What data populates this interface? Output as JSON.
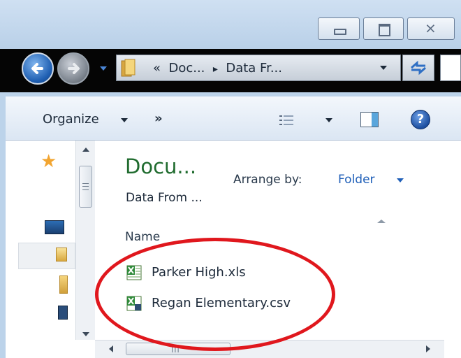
{
  "window": {
    "caption_buttons": [
      "minimize",
      "maximize",
      "close"
    ],
    "close_glyph": "⨯"
  },
  "address_bar": {
    "breadcrumb_prefix": "«",
    "breadcrumb": [
      "Doc...",
      "Data Fr..."
    ],
    "separator": "▸"
  },
  "toolbar": {
    "organize_label": "Organize",
    "more_label": "»",
    "help_label": "?"
  },
  "library": {
    "title": "Docu...",
    "subtitle": "Data From ...",
    "arrange_by_label": "Arrange by:",
    "arrange_by_value": "Folder"
  },
  "file_list": {
    "column_header": "Name",
    "files": [
      {
        "name": "Parker High.xls",
        "icon": "excel-file-icon"
      },
      {
        "name": "Regan Elementary.csv",
        "icon": "excel-csv-file-icon"
      }
    ]
  },
  "hscroll_grip": "III",
  "annotation": {
    "color": "#e0171d",
    "shape": "ellipse"
  }
}
